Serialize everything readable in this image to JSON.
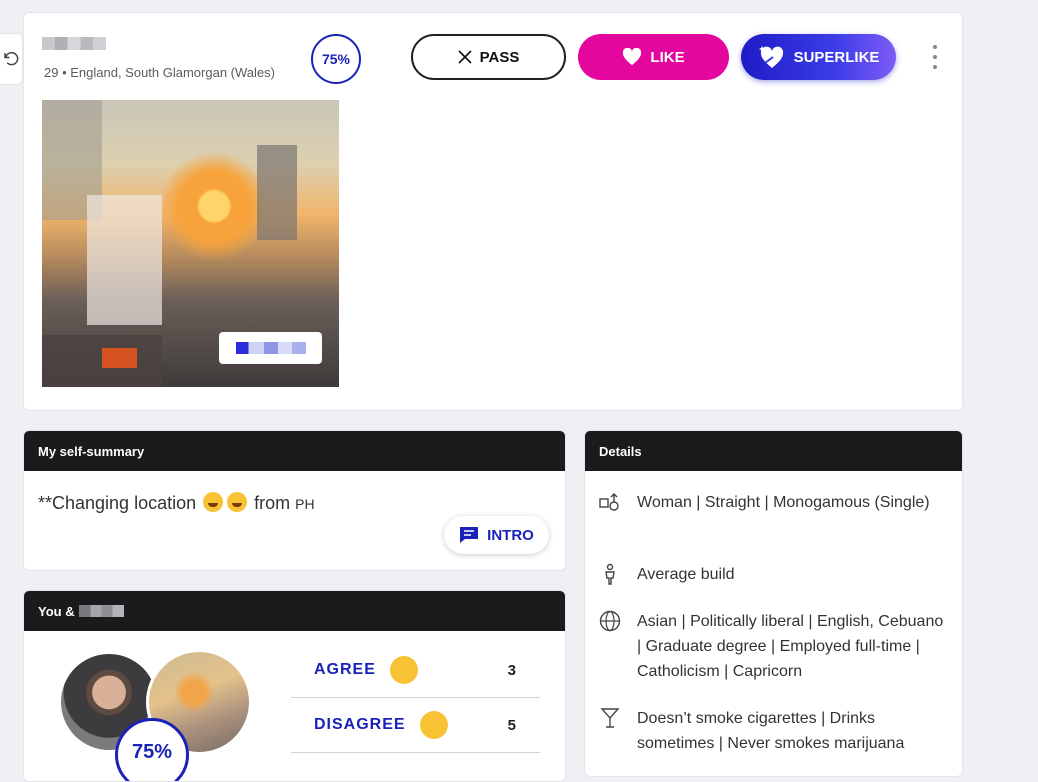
{
  "profile": {
    "meta": "29 • England, South Glamorgan (Wales)",
    "match_percent": "75%"
  },
  "actions": {
    "pass": "PASS",
    "like": "LIKE",
    "superlike": "SUPERLIKE"
  },
  "summary": {
    "title": "My self-summary",
    "text_before": "**Changing location",
    "text_from": "from",
    "text_suffix": "PH",
    "intro_button": "INTRO"
  },
  "details": {
    "title": "Details",
    "rows": [
      {
        "icon": "gender-icon",
        "text": "Woman | Straight | Monogamous (Single)"
      },
      {
        "icon": "body-icon",
        "text": "Average build"
      },
      {
        "icon": "globe-icon",
        "text": "Asian | Politically liberal | English, Cebuano | Graduate degree | Employed full-time | Catholicism | Capricorn"
      },
      {
        "icon": "cocktail-icon",
        "text": "Doesn’t smoke cigarettes | Drinks sometimes | Never smokes marijuana"
      }
    ]
  },
  "you": {
    "title": "You &",
    "match_percent": "75%",
    "answers": [
      {
        "label": "AGREE",
        "count": "3"
      },
      {
        "label": "DISAGREE",
        "count": "5"
      }
    ]
  },
  "colors": {
    "accent_blue": "#1a22b8",
    "like_pink": "#e3079e",
    "header_dark": "#1b1b1d"
  }
}
